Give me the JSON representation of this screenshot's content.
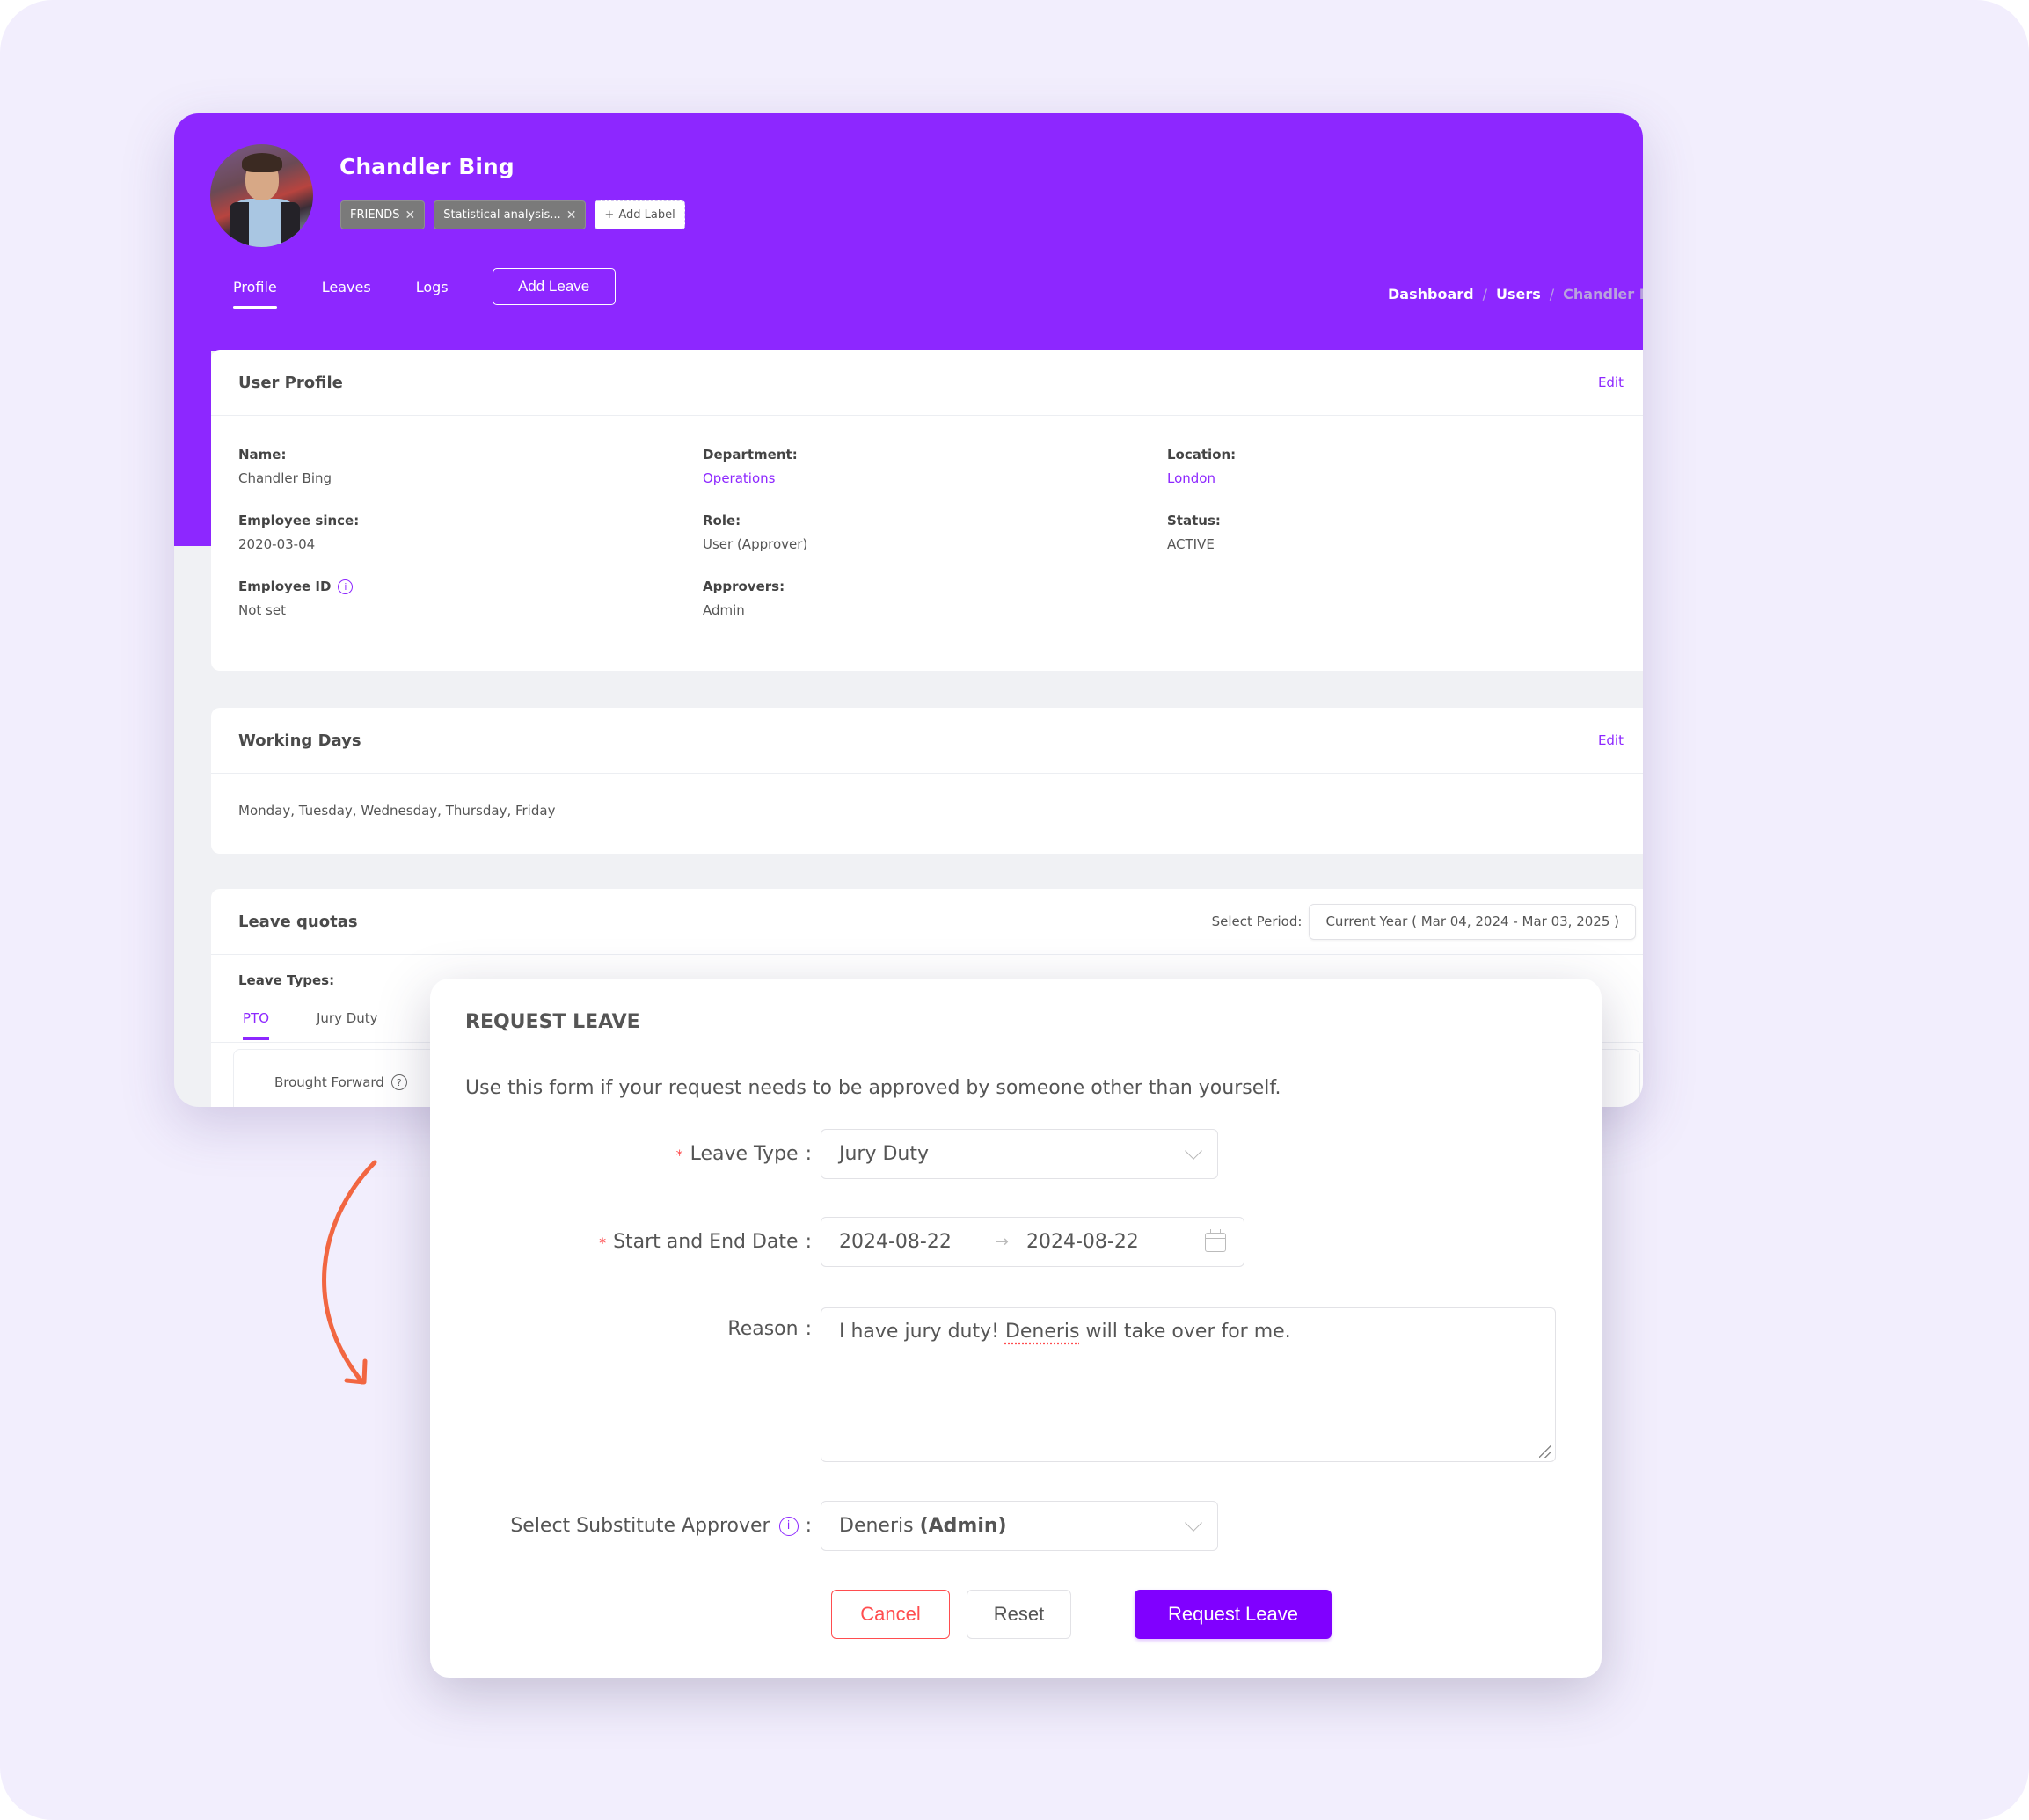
{
  "colors": {
    "brand": "#8d27ff",
    "primary_button": "#8000ff",
    "danger": "#ff4d4f",
    "annotation_arrow": "#f26641",
    "frame_background": "#f2eefd"
  },
  "header": {
    "user_name": "Chandler Bing",
    "avatar_icon": "user-photo",
    "tags": [
      {
        "label": "FRIENDS",
        "remove_icon": "close-icon"
      },
      {
        "label": "Statistical analysis...",
        "remove_icon": "close-icon"
      }
    ],
    "add_label": "Add Label",
    "tabs": [
      {
        "label": "Profile",
        "active": true
      },
      {
        "label": "Leaves",
        "active": false
      },
      {
        "label": "Logs",
        "active": false
      }
    ],
    "add_leave_button": "Add Leave",
    "breadcrumb": [
      "Dashboard",
      "Users",
      "Chandler Bi"
    ],
    "breadcrumb_separator": "/"
  },
  "user_profile": {
    "title": "User Profile",
    "edit_label": "Edit",
    "fields": [
      {
        "label": "Name:",
        "value": "Chandler Bing",
        "link": false
      },
      {
        "label": "Department:",
        "value": "Operations",
        "link": true
      },
      {
        "label": "Location:",
        "value": "London",
        "link": true
      },
      {
        "label": "Employee since:",
        "value": "2020-03-04",
        "link": false
      },
      {
        "label": "Role:",
        "value": "User (Approver)",
        "link": false
      },
      {
        "label": "Status:",
        "value": "ACTIVE",
        "link": false
      },
      {
        "label": "Employee ID",
        "value": "Not set",
        "link": false,
        "info_icon": "info-icon"
      },
      {
        "label": "Approvers:",
        "value": "Admin",
        "link": false
      }
    ]
  },
  "working_days": {
    "title": "Working Days",
    "edit_label": "Edit",
    "value": "Monday, Tuesday, Wednesday, Thursday, Friday"
  },
  "leave_quotas": {
    "title": "Leave quotas",
    "select_period_label": "Select Period:",
    "selected_period": "Current Year ( Mar 04, 2024 - Mar 03, 2025 )",
    "leave_types_label": "Leave Types:",
    "leave_types": [
      {
        "label": "PTO",
        "active": true
      },
      {
        "label": "Jury Duty",
        "active": false
      }
    ],
    "brought_forward_label": "Brought Forward"
  },
  "modal": {
    "title": "REQUEST LEAVE",
    "description": "Use this form if your request needs to be approved by someone other than yourself.",
    "leave_type": {
      "label": "Leave Type",
      "required": true,
      "value": "Jury Duty"
    },
    "date_range": {
      "label": "Start and End Date",
      "required": true,
      "start": "2024-08-22",
      "end": "2024-08-22",
      "separator": "→"
    },
    "reason": {
      "label": "Reason",
      "value_before": "I have jury duty! ",
      "value_misspelled": "Deneris",
      "value_after": " will take over for me."
    },
    "substitute_approver": {
      "label": "Select Substitute Approver",
      "value_name": "Deneris",
      "value_role": "(Admin)"
    },
    "buttons": {
      "cancel": "Cancel",
      "reset": "Reset",
      "submit": "Request Leave"
    }
  }
}
